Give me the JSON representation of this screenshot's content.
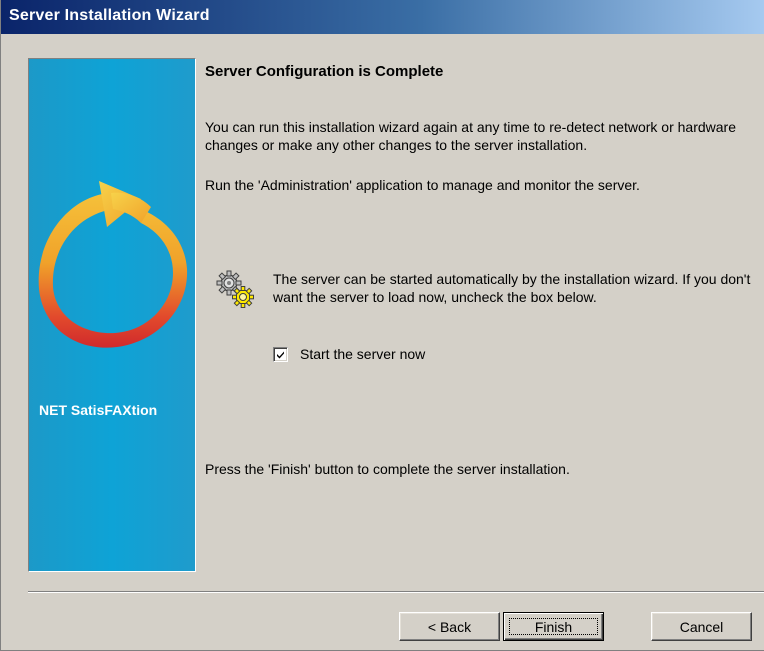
{
  "window": {
    "title": "Server Installation Wizard"
  },
  "side_panel": {
    "brand": "NET SatisFAXtion",
    "logo_icon": "circular-arrow-logo-icon",
    "background_color": "#0ea3d6"
  },
  "content": {
    "heading": "Server Configuration is Complete",
    "paragraph1": "You can run this installation wizard again at any time to re-detect network or hardware changes or make any other changes to the server installation.",
    "paragraph2": "Run the 'Administration' application to manage and monitor the server.",
    "info_icon": "gears-icon",
    "info_text": "The server can be started automatically by the installation wizard. If you don't want the server to load now, uncheck the box below.",
    "checkbox": {
      "label": "Start the server now",
      "checked": true
    },
    "paragraph3": "Press the 'Finish' button to complete the server installation."
  },
  "buttons": {
    "back": "< Back",
    "finish": "Finish",
    "cancel": "Cancel"
  },
  "colors": {
    "titlebar_start": "#0a246a",
    "titlebar_end": "#a6caf0",
    "dialog_face": "#d4d0c8"
  }
}
